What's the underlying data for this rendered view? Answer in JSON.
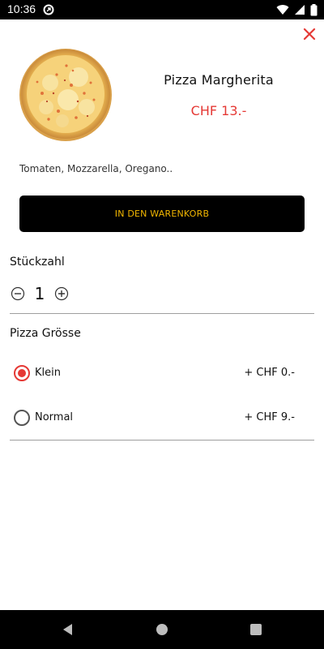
{
  "status_bar": {
    "time": "10:36"
  },
  "product": {
    "name": "Pizza Margherita",
    "price": "CHF 13.-",
    "description": "Tomaten, Mozzarella, Oregano.."
  },
  "actions": {
    "add_to_cart_label": "IN DEN WARENKORB"
  },
  "quantity": {
    "title": "Stückzahl",
    "value": "1"
  },
  "size": {
    "title": "Pizza Grösse",
    "options": [
      {
        "label": "Klein",
        "price": "+ CHF 0.-",
        "selected": true
      },
      {
        "label": "Normal",
        "price": "+ CHF 9.-",
        "selected": false
      }
    ]
  },
  "colors": {
    "accent": "#e53935",
    "button_text": "#f2b600",
    "button_bg": "#000000"
  },
  "icons": {
    "close": "close-icon",
    "minus": "minus-circle-icon",
    "plus": "plus-circle-icon",
    "nav_back": "back-triangle-icon",
    "nav_home": "home-circle-icon",
    "nav_recent": "recent-square-icon"
  }
}
